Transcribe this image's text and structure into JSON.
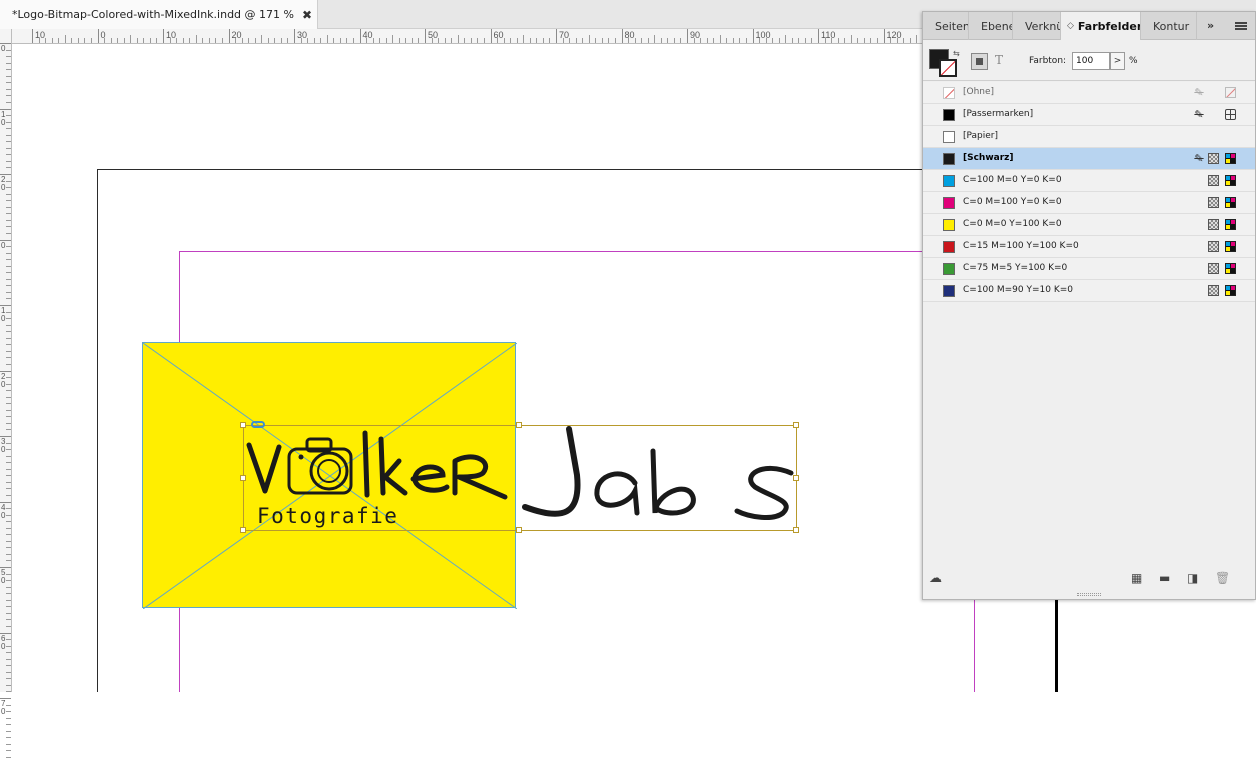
{
  "document": {
    "tab_title": "*Logo-Bitmap-Colored-with-MixedInk.indd @ 171 %",
    "close_glyph": "✖"
  },
  "ruler": {
    "h_labels": [
      "10",
      "0",
      "10",
      "20",
      "30",
      "40",
      "50",
      "60",
      "70",
      "80",
      "90",
      "100",
      "110",
      "120"
    ],
    "v_labels": [
      "0",
      "1 0",
      "2 0",
      "0",
      "1 0",
      "2 0",
      "3 0",
      "4 0",
      "5 0",
      "6 0",
      "7 0"
    ]
  },
  "artwork": {
    "logo_primary": "VolkeR",
    "logo_secondary": "Jabs",
    "logo_tagline": "Fotografie",
    "frame_fill": "#ffee00"
  },
  "panel": {
    "tabs": [
      {
        "label": "Seiten",
        "active": false
      },
      {
        "label": "Ebene",
        "active": false
      },
      {
        "label": "Verknü",
        "active": false
      },
      {
        "label": "Farbfelder",
        "active": true
      },
      {
        "label": "Kontur",
        "active": false
      }
    ],
    "more_glyph": "»",
    "fill_color": "#1a1a1a",
    "text_format_glyph": "T",
    "tint_label": "Farbton:",
    "tint_value": "100",
    "tint_arrow": ">",
    "tint_unit": "%",
    "swatches": [
      {
        "name": "[Ohne]",
        "color": "none",
        "icons": [
          "no-edit",
          "none"
        ],
        "selected": false,
        "dim": true
      },
      {
        "name": "[Passermarken]",
        "color": "#000000",
        "icons": [
          "no-edit",
          "registration"
        ],
        "selected": false,
        "dim": false
      },
      {
        "name": "[Papier]",
        "color": "#ffffff",
        "icons": [],
        "selected": false,
        "dim": false
      },
      {
        "name": "[Schwarz]",
        "color": "#1a1a1a",
        "icons": [
          "no-edit",
          "process",
          "cmyk"
        ],
        "selected": true,
        "dim": false
      },
      {
        "name": "C=100 M=0 Y=0 K=0",
        "color": "#00a0e0",
        "icons": [
          "process",
          "cmyk"
        ],
        "selected": false,
        "dim": false
      },
      {
        "name": "C=0 M=100 Y=0 K=0",
        "color": "#e0007a",
        "icons": [
          "process",
          "cmyk"
        ],
        "selected": false,
        "dim": false
      },
      {
        "name": "C=0 M=0 Y=100 K=0",
        "color": "#ffed00",
        "icons": [
          "process",
          "cmyk"
        ],
        "selected": false,
        "dim": false
      },
      {
        "name": "C=15 M=100 Y=100 K=0",
        "color": "#c9161c",
        "icons": [
          "process",
          "cmyk"
        ],
        "selected": false,
        "dim": false
      },
      {
        "name": "C=75 M=5 Y=100 K=0",
        "color": "#3a9a35",
        "icons": [
          "process",
          "cmyk"
        ],
        "selected": false,
        "dim": false
      },
      {
        "name": "C=100 M=90 Y=10 K=0",
        "color": "#1f2f7a",
        "icons": [
          "process",
          "cmyk"
        ],
        "selected": false,
        "dim": false
      }
    ],
    "footer_icons": [
      "cc-libraries-icon",
      "new-color-group-icon",
      "new-folder-icon",
      "new-swatch-icon",
      "delete-swatch-icon"
    ]
  }
}
